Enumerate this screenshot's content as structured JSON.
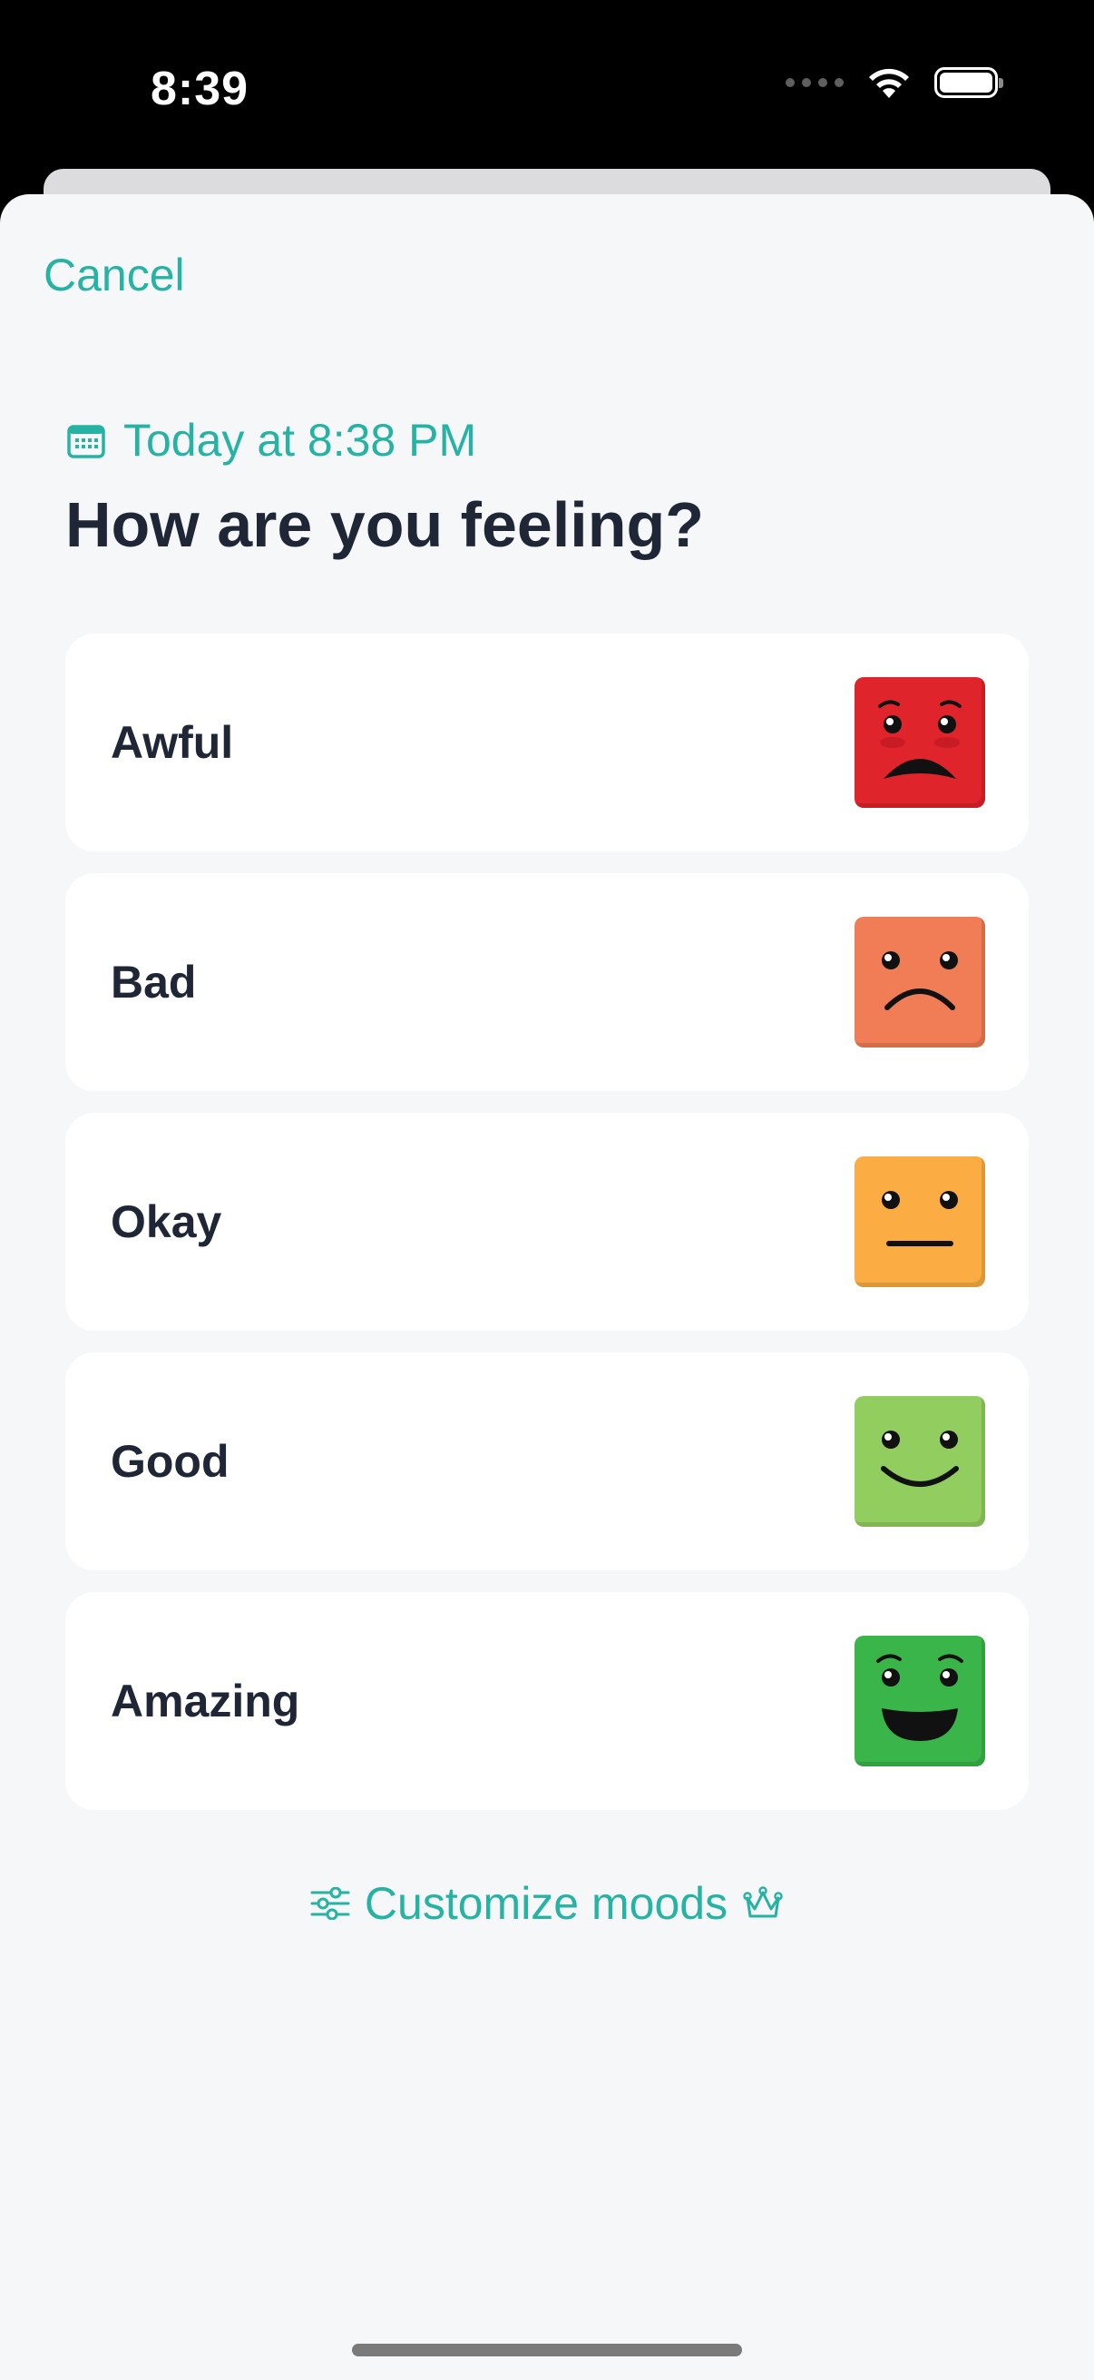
{
  "status_bar": {
    "time": "8:39"
  },
  "header": {
    "cancel_label": "Cancel",
    "date_text": "Today at 8:38 PM",
    "title": "How are you feeling?"
  },
  "moods": [
    {
      "label": "Awful",
      "color": "#e0242b",
      "icon": "awful-face-icon"
    },
    {
      "label": "Bad",
      "color": "#f07d55",
      "icon": "bad-face-icon"
    },
    {
      "label": "Okay",
      "color": "#fbac43",
      "icon": "okay-face-icon"
    },
    {
      "label": "Good",
      "color": "#92ce5f",
      "icon": "good-face-icon"
    },
    {
      "label": "Amazing",
      "color": "#3ab54a",
      "icon": "amazing-face-icon"
    }
  ],
  "footer": {
    "customize_label": "Customize moods"
  },
  "colors": {
    "accent": "#26b3a3",
    "title": "#1f2636",
    "sheet_background": "#f6f7f9"
  }
}
